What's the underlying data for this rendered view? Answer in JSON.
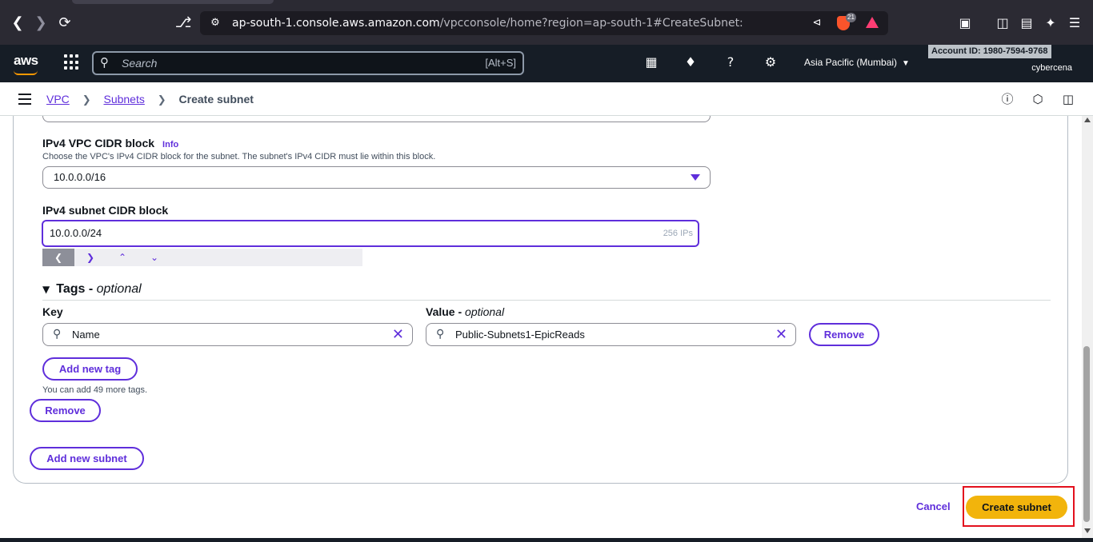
{
  "browser": {
    "url_host": "ap-south-1.console.aws.amazon.com",
    "url_path": "/vpcconsole/home?region=ap-south-1#CreateSubnet:",
    "shield_count": "21"
  },
  "aws_header": {
    "logo": "aws",
    "search_placeholder": "Search",
    "search_shortcut": "[Alt+S]",
    "region": "Asia Pacific (Mumbai)",
    "account_id": "Account ID: 1980-7594-9768",
    "username": "cybercena"
  },
  "breadcrumb": {
    "items": [
      "VPC",
      "Subnets"
    ],
    "current": "Create subnet"
  },
  "form": {
    "vpc_cidr": {
      "label": "IPv4 VPC CIDR block",
      "info": "Info",
      "description": "Choose the VPC's IPv4 CIDR block for the subnet. The subnet's IPv4 CIDR must lie within this block.",
      "value": "10.0.0.0/16"
    },
    "subnet_cidr": {
      "label": "IPv4 subnet CIDR block",
      "value": "10.0.0.0/24",
      "hint": "256 IPs"
    },
    "tags": {
      "title": "Tags -",
      "optional": "optional",
      "key_label": "Key",
      "value_label": "Value -",
      "value_optional": "optional",
      "key_value": "Name",
      "value_value": "Public-Subnets1-EpicReads",
      "remove_label": "Remove",
      "add_tag_label": "Add new tag",
      "note": "You can add 49 more tags."
    },
    "remove_subnet_label": "Remove",
    "add_subnet_label": "Add new subnet"
  },
  "footer": {
    "cancel_label": "Cancel",
    "create_label": "Create subnet"
  },
  "colors": {
    "accent": "#5f2edb",
    "primary_button": "#f2b40c",
    "header_bg": "#161d26",
    "highlight": "#e3101d"
  }
}
